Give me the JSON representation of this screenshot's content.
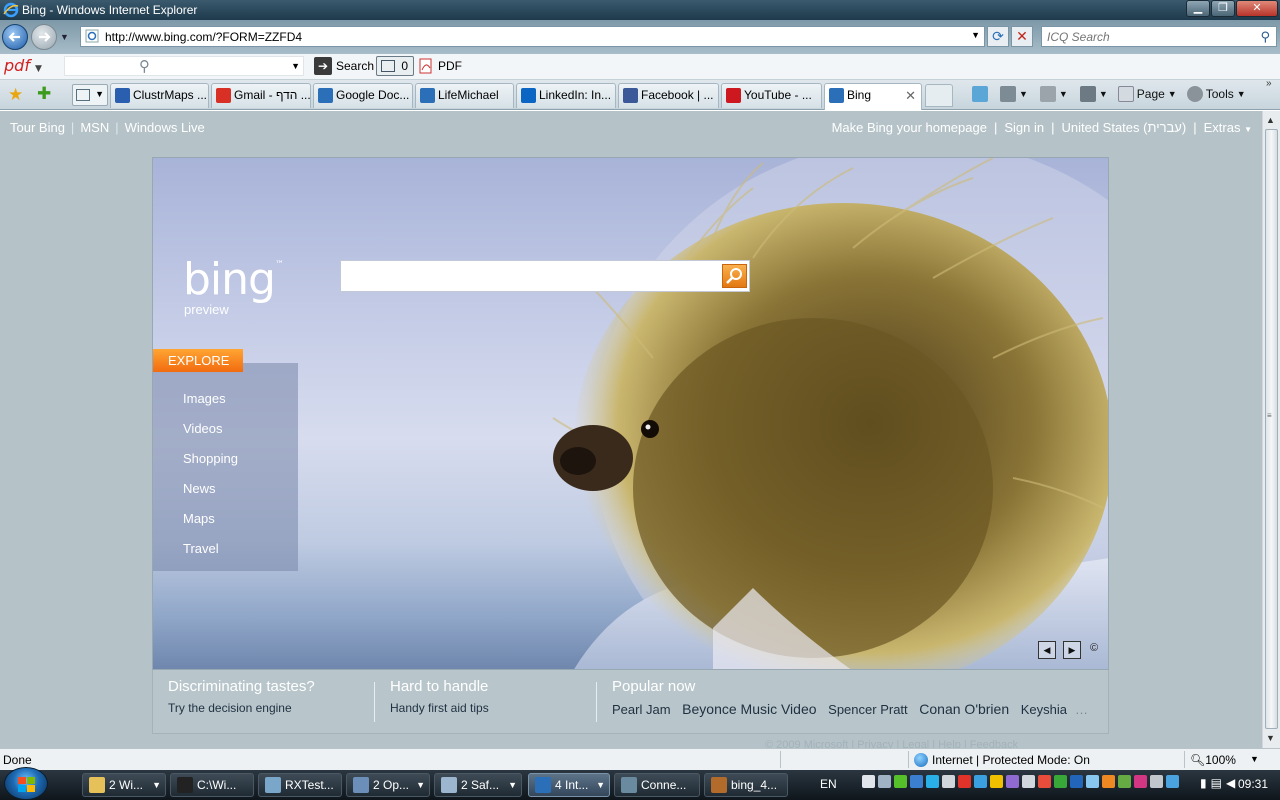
{
  "window": {
    "title": "Bing - Windows Internet Explorer",
    "controls": [
      "minimize",
      "maximize",
      "close"
    ]
  },
  "address_bar": {
    "url": "http://www.bing.com/?FORM=ZZFD4",
    "search_placeholder": "ICQ Search"
  },
  "toolbar": {
    "logo": "pdf",
    "search_label": "Search",
    "counter": "0",
    "pdf_label": "PDF"
  },
  "tabs": [
    {
      "label": "ClustrMaps ...",
      "icon": "clustrmaps-icon",
      "color": "#2a5fb0"
    },
    {
      "label": "Gmail - הדף ...",
      "icon": "gmail-icon",
      "color": "#d93025"
    },
    {
      "label": "Google Doc...",
      "icon": "ie-page-icon",
      "color": "#2a6fb8"
    },
    {
      "label": "LifeMichael",
      "icon": "ie-page-icon",
      "color": "#2a6fb8"
    },
    {
      "label": "LinkedIn: In...",
      "icon": "linkedin-icon",
      "color": "#0a66c2"
    },
    {
      "label": "Facebook | ...",
      "icon": "facebook-icon",
      "color": "#3b5998"
    },
    {
      "label": "YouTube - ...",
      "icon": "youtube-icon",
      "color": "#cc181e"
    },
    {
      "label": "Bing",
      "icon": "ie-page-icon",
      "color": "#2a6fb8",
      "active": true
    }
  ],
  "command_bar": {
    "page_label": "Page",
    "tools_label": "Tools"
  },
  "bing": {
    "top_left_links": [
      "Tour Bing",
      "MSN",
      "Windows Live"
    ],
    "top_right_links": [
      "Make Bing your homepage",
      "Sign in",
      "United States (עברית)",
      "Extras"
    ],
    "logo": "bing",
    "logo_sub": "preview",
    "search_value": "",
    "explore_label": "EXPLORE",
    "explore_links": [
      "Images",
      "Videos",
      "Shopping",
      "News",
      "Maps",
      "Travel"
    ],
    "slide_prev": "◀",
    "slide_next": "▶",
    "footer_cols": [
      {
        "heading": "Discriminating tastes?",
        "sub": "Try the decision engine"
      },
      {
        "heading": "Hard to handle",
        "sub": "Handy first aid tips"
      }
    ],
    "popular_heading": "Popular now",
    "popular_items": [
      "Pearl Jam",
      "Beyonce Music Video",
      "Spencer Pratt",
      "Conan O'brien",
      "Keyshia"
    ],
    "faded_footer": "© 2009 Microsoft  |  Privacy  |  Legal  |  Help  |  Feedback"
  },
  "status_bar": {
    "status": "Done",
    "zone": "Internet | Protected Mode: On",
    "zoom": "100%"
  },
  "taskbar": {
    "items": [
      {
        "label": "2 Wi...",
        "color": "#e6c15a"
      },
      {
        "label": "C:\\Wi...",
        "color": "#222"
      },
      {
        "label": "RXTest...",
        "color": "#7aa7c9"
      },
      {
        "label": "2 Op...",
        "color": "#6b8fb8"
      },
      {
        "label": "2 Saf...",
        "color": "#9db6d0"
      },
      {
        "label": "4 Int...",
        "color": "#2a6fb8",
        "active": true
      },
      {
        "label": "Conne...",
        "color": "#6a8aa0"
      },
      {
        "label": "bing_4...",
        "color": "#b36b2b"
      }
    ],
    "language": "EN",
    "clock": "09:31"
  }
}
